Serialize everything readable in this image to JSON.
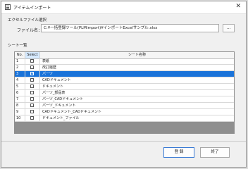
{
  "window": {
    "title": "アイテムインポート"
  },
  "file_section": {
    "heading": "エクセルファイル選択",
    "label": "ファイル名：",
    "value": "C:¥一括登録ツール(PLMimport)¥インポートExcelサンプル.xlsx",
    "browse_label": "..."
  },
  "sheet_section": {
    "heading": "シート一覧"
  },
  "table": {
    "columns": {
      "no": "No.",
      "select": "Select",
      "name": "シート名称"
    },
    "rows": [
      {
        "no": "1",
        "name": "表紙",
        "selected": false
      },
      {
        "no": "2",
        "name": "改訂履歴",
        "selected": false
      },
      {
        "no": "3",
        "name": "パーツ",
        "selected": true
      },
      {
        "no": "4",
        "name": "CADドキュメント",
        "selected": false
      },
      {
        "no": "5",
        "name": "ドキュメント",
        "selected": false
      },
      {
        "no": "6",
        "name": "パーツ_部品表",
        "selected": false
      },
      {
        "no": "7",
        "name": "パーツ_CADドキュメント",
        "selected": false
      },
      {
        "no": "8",
        "name": "パーツ_ドキュメント",
        "selected": false
      },
      {
        "no": "9",
        "name": "CADドキュメント_CADドキュメント",
        "selected": false
      },
      {
        "no": "10",
        "name": "ドキュメント_ファイル",
        "selected": false
      }
    ]
  },
  "buttons": {
    "register": "登 録",
    "exit": "終了"
  },
  "colors": {
    "selection": "#1a73d9",
    "select_header": "#d6eaff"
  }
}
